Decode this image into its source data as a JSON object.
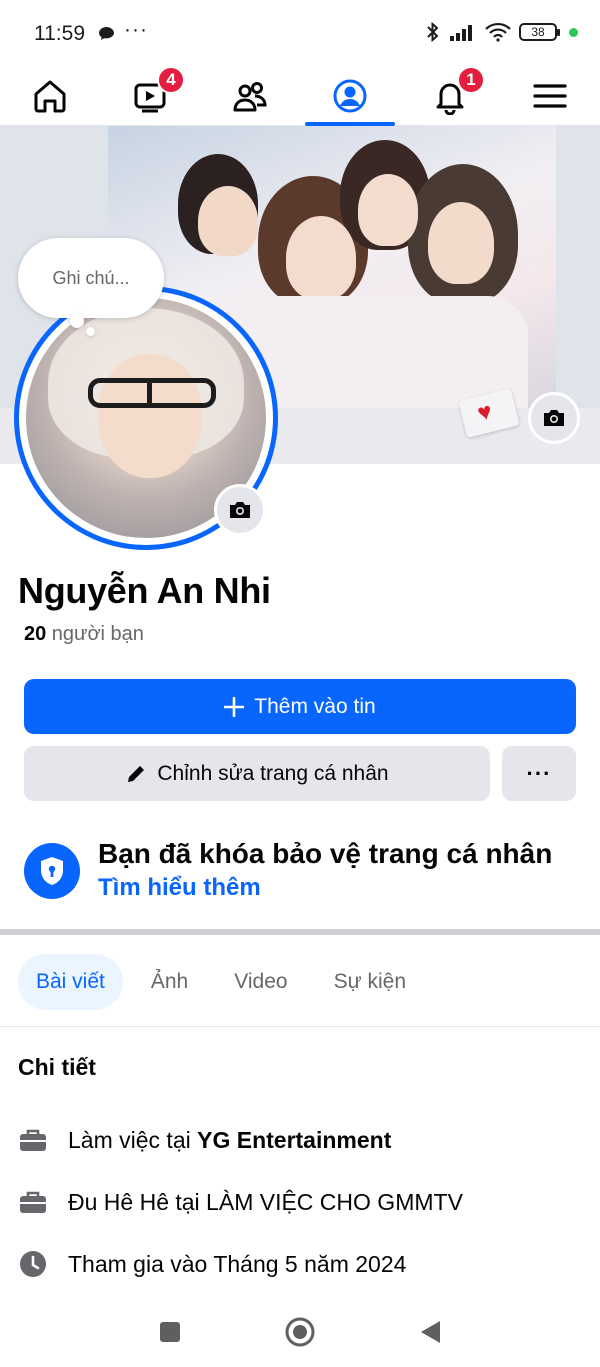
{
  "status_bar": {
    "time": "11:59",
    "dots": "···",
    "battery": "38"
  },
  "nav": {
    "items": [
      {
        "name": "home",
        "badge": ""
      },
      {
        "name": "video",
        "badge": "4"
      },
      {
        "name": "friends",
        "badge": ""
      },
      {
        "name": "profile",
        "badge": ""
      },
      {
        "name": "notifications",
        "badge": "1"
      },
      {
        "name": "menu",
        "badge": ""
      }
    ],
    "active": "profile"
  },
  "profile": {
    "note_placeholder": "Ghi chú...",
    "name": "Nguyễn An Nhi",
    "friends_count": "20",
    "friends_label": " người bạn"
  },
  "actions": {
    "add_story": "Thêm vào tin",
    "edit_profile": "Chỉnh sửa trang cá nhân",
    "more": "···"
  },
  "locked": {
    "title": "Bạn đã khóa bảo vệ trang cá nhân",
    "link": "Tìm hiểu thêm"
  },
  "tabs": [
    {
      "label": "Bài viết",
      "active": true
    },
    {
      "label": "Ảnh",
      "active": false
    },
    {
      "label": "Video",
      "active": false
    },
    {
      "label": "Sự kiện",
      "active": false
    }
  ],
  "details": {
    "title": "Chi tiết",
    "work_prefix": "Làm việc tại ",
    "work_company": "YG Entertainment",
    "work2": "Đu Hê Hê tại LÀM VIỆC CHO GMMTV",
    "joined": "Tham gia vào Tháng 5 năm 2024"
  },
  "colors": {
    "accent": "#0866ff",
    "badge": "#e41e3f",
    "secondary_bg": "#e4e6eb"
  }
}
